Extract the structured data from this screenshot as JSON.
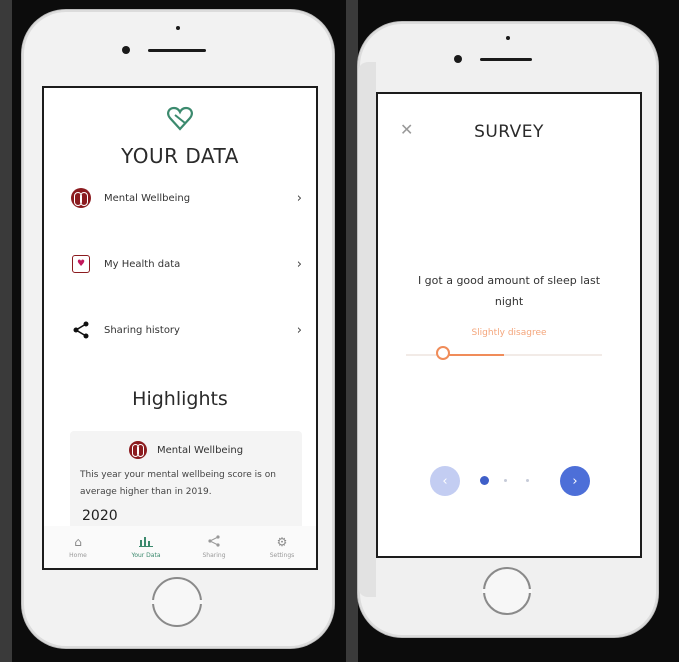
{
  "left_phone": {
    "title": "YOUR DATA",
    "menu": [
      {
        "label": "Mental Wellbeing",
        "icon": "brain-icon"
      },
      {
        "label": "My Health data",
        "icon": "health-heart-icon"
      },
      {
        "label": "Sharing history",
        "icon": "share-icon"
      }
    ],
    "highlights_title": "Highlights",
    "card": {
      "title": "Mental Wellbeing",
      "text": "This year your mental wellbeing score is on average higher than in 2019.",
      "year": "2020"
    },
    "tabs": [
      {
        "label": "Home",
        "icon": "home-icon",
        "active": false
      },
      {
        "label": "Your Data",
        "icon": "chart-icon",
        "active": true
      },
      {
        "label": "Sharing",
        "icon": "share-icon",
        "active": false
      },
      {
        "label": "Settings",
        "icon": "gear-icon",
        "active": false
      }
    ]
  },
  "right_phone": {
    "title": "SURVEY",
    "close_icon": "close-icon",
    "question": "I got a good amount of sleep last night",
    "slider": {
      "value_label": "Slightly disagree",
      "level": 0.2
    },
    "pagination": {
      "current": 1,
      "total": 3
    },
    "prev_icon": "chevron-left-icon",
    "next_icon": "chevron-right-icon"
  },
  "colors": {
    "accent_green": "#3c8a6e",
    "brain_red": "#8b1b1f",
    "slider_orange": "#f08c59",
    "nav_blue": "#4d6fd8"
  }
}
